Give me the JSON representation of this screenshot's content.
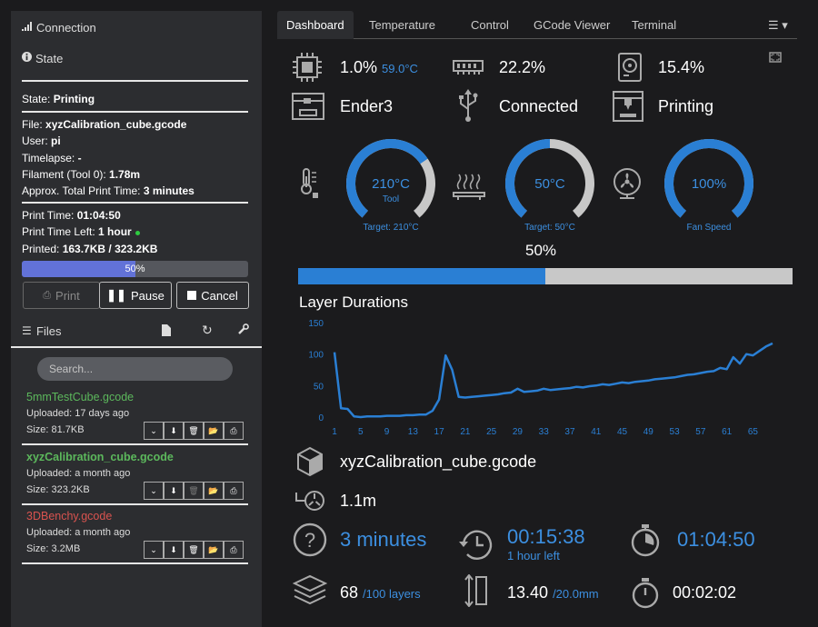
{
  "sidebar": {
    "connection_label": "Connection",
    "state_label": "State",
    "state_prefix": "State:",
    "state_value": "Printing",
    "file_prefix": "File:",
    "file_value": "xyzCalibration_cube.gcode",
    "user_prefix": "User:",
    "user_value": "pi",
    "timelapse_prefix": "Timelapse:",
    "timelapse_value": "-",
    "filament_prefix": "Filament (Tool 0):",
    "filament_value": "1.78m",
    "approx_prefix": "Approx. Total Print Time:",
    "approx_value": "3 minutes",
    "print_time_prefix": "Print Time:",
    "print_time_value": "01:04:50",
    "time_left_prefix": "Print Time Left:",
    "time_left_value": "1 hour",
    "printed_prefix": "Printed:",
    "printed_value": "163.7KB / 323.2KB",
    "progress_text": "50%",
    "progress_fraction": 0.5,
    "print_label": "Print",
    "pause_label": "Pause",
    "cancel_label": "Cancel",
    "files_label": "Files",
    "search_placeholder": "Search...",
    "files": [
      {
        "name": "5mmTestCube.gcode",
        "uploaded": "Uploaded: 17 days ago",
        "size": "Size: 81.7KB",
        "color": "#5cb85c",
        "bold": false
      },
      {
        "name": "xyzCalibration_cube.gcode",
        "uploaded": "Uploaded: a month ago",
        "size": "Size: 323.2KB",
        "color": "#5cb85c",
        "bold": true
      },
      {
        "name": "3DBenchy.gcode",
        "uploaded": "Uploaded: a month ago",
        "size": "Size: 3.2MB",
        "color": "#d9534f",
        "bold": false
      }
    ]
  },
  "tabs": [
    "Dashboard",
    "Temperature",
    "Control",
    "GCode Viewer",
    "Terminal"
  ],
  "dashboard": {
    "cpu_load": "1.0%",
    "cpu_temp": "59.0°C",
    "mem": "22.2%",
    "disk": "15.4%",
    "printer_name": "Ender3",
    "connection": "Connected",
    "state": "Printing",
    "gauges": [
      {
        "value": "210°C",
        "sub": "Tool",
        "target": "Target: 210°C",
        "fraction": 0.7
      },
      {
        "value": "50°C",
        "sub": "",
        "target": "Target: 50°C",
        "fraction": 0.5
      },
      {
        "value": "100%",
        "sub": "",
        "target": "Fan Speed",
        "fraction": 1.0
      }
    ],
    "progress_label": "50%",
    "progress_fraction": 0.5,
    "chart_title": "Layer Durations",
    "filename": "xyzCalibration_cube.gcode",
    "filament": "1.1m",
    "est_time": "3 minutes",
    "elapsed": "00:15:38",
    "left": "1 hour left",
    "print_time": "01:04:50",
    "layer": "68",
    "layer_total": "/100 layers",
    "height": "13.40",
    "height_total": "/20.0mm",
    "layer_time": "00:02:02"
  },
  "colors": {
    "accent": "#3c8fe0",
    "bar": "#2a7fd4",
    "track": "#c8c8c8"
  },
  "chart_data": {
    "type": "line",
    "title": "Layer Durations",
    "xlabel": "",
    "ylabel": "",
    "ylim": [
      0,
      150
    ],
    "yticks": [
      0,
      50,
      100,
      150
    ],
    "xticks": [
      1,
      5,
      9,
      13,
      17,
      21,
      25,
      29,
      33,
      37,
      41,
      45,
      49,
      53,
      57,
      61,
      65
    ],
    "x": [
      1,
      2,
      3,
      4,
      5,
      6,
      7,
      8,
      9,
      10,
      11,
      12,
      13,
      14,
      15,
      16,
      17,
      18,
      19,
      20,
      21,
      22,
      23,
      24,
      25,
      26,
      27,
      28,
      29,
      30,
      31,
      32,
      33,
      34,
      35,
      36,
      37,
      38,
      39,
      40,
      41,
      42,
      43,
      44,
      45,
      46,
      47,
      48,
      49,
      50,
      51,
      52,
      53,
      54,
      55,
      56,
      57,
      58,
      59,
      60,
      61,
      62,
      63,
      64,
      65,
      66,
      67,
      68
    ],
    "y": [
      103,
      14,
      13,
      1,
      0,
      1,
      1,
      1,
      2,
      2,
      2,
      3,
      3,
      4,
      4,
      10,
      28,
      98,
      75,
      32,
      31,
      32,
      33,
      34,
      35,
      36,
      38,
      39,
      45,
      40,
      41,
      42,
      45,
      43,
      44,
      45,
      46,
      48,
      47,
      49,
      50,
      52,
      51,
      53,
      55,
      54,
      56,
      57,
      58,
      60,
      61,
      62,
      63,
      65,
      67,
      68,
      70,
      72,
      73,
      78,
      76,
      95,
      85,
      100,
      98,
      105,
      112,
      117,
      110,
      114,
      109,
      119
    ]
  }
}
